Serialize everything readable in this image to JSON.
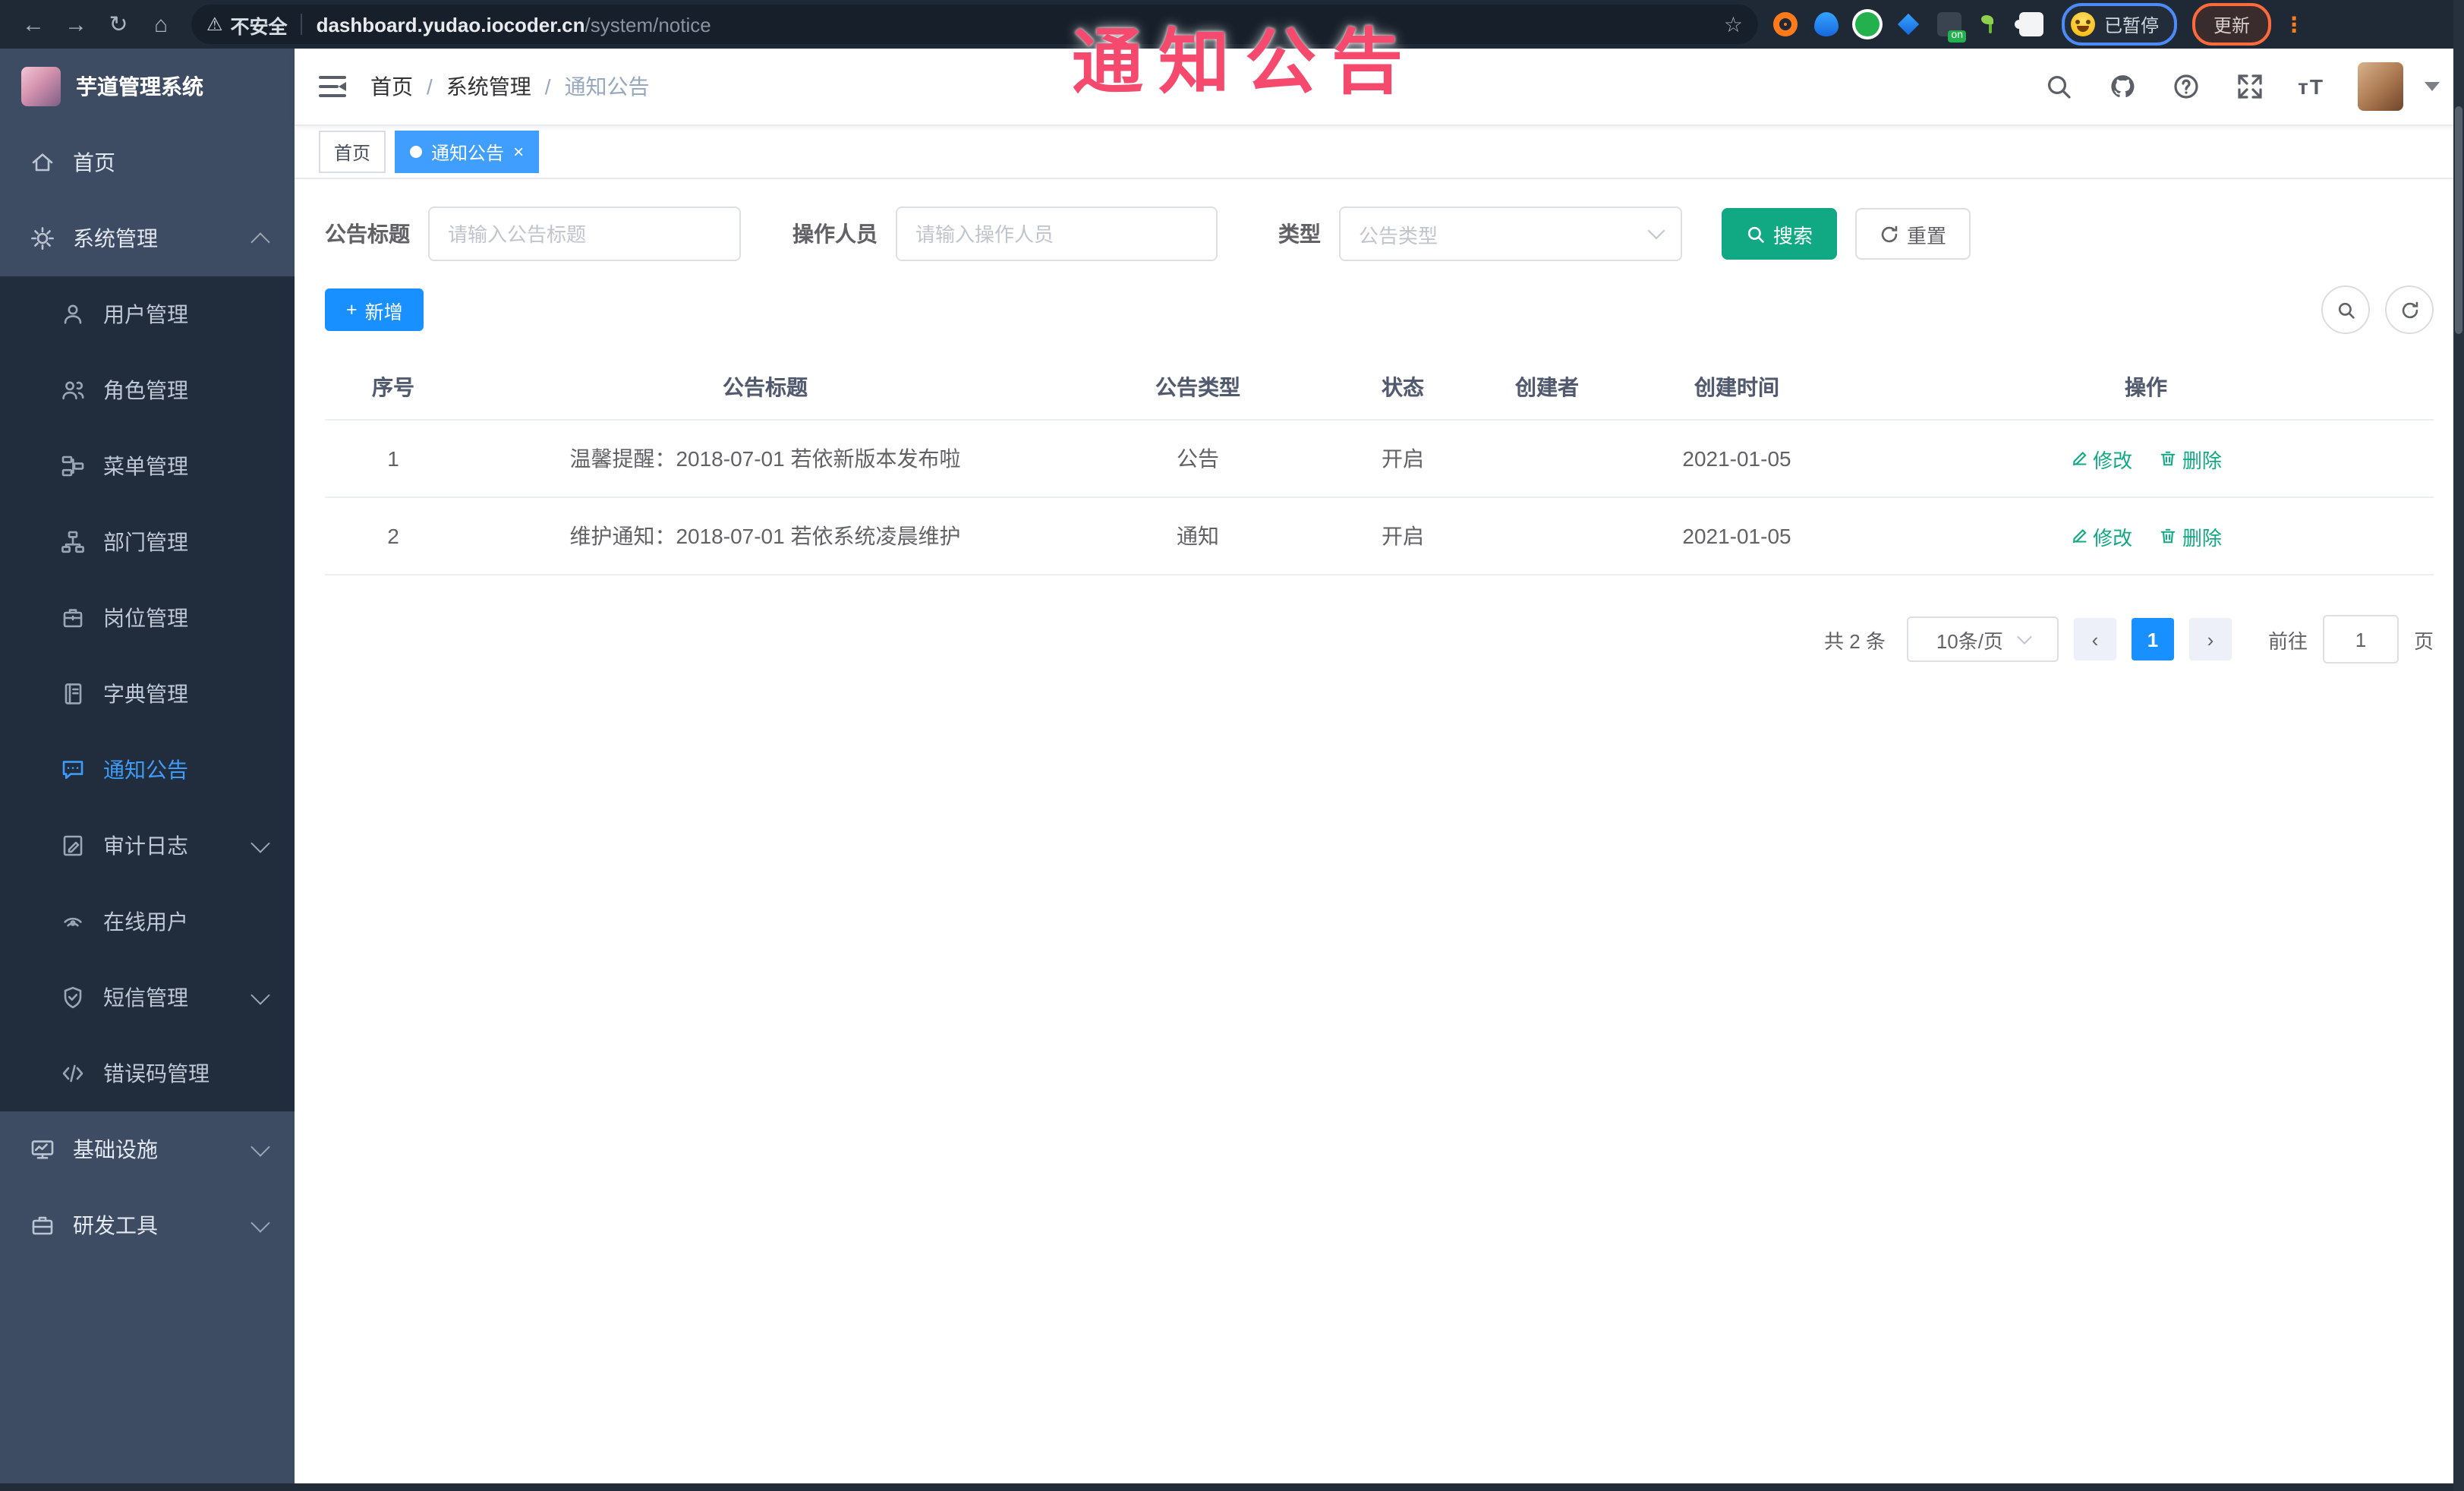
{
  "watermark": {
    "text": "通知公告",
    "color": "#f54a6e"
  },
  "browser": {
    "back_icon": "←",
    "forward_icon": "→",
    "reload_icon": "↻",
    "home_icon": "⌂",
    "warning_icon": "⚠",
    "security_label": "不安全",
    "url_host": "dashboard.yudao.iocoder.cn",
    "url_path": "/system/notice",
    "star_icon": "☆",
    "profile_label": "已暂停",
    "update_label": "更新",
    "menu_icon": "⋮"
  },
  "sidebar": {
    "logo_title": "芋道管理系统",
    "items": [
      {
        "label": "首页"
      },
      {
        "label": "系统管理"
      },
      {
        "label": "用户管理"
      },
      {
        "label": "角色管理"
      },
      {
        "label": "菜单管理"
      },
      {
        "label": "部门管理"
      },
      {
        "label": "岗位管理"
      },
      {
        "label": "字典管理"
      },
      {
        "label": "通知公告"
      },
      {
        "label": "审计日志"
      },
      {
        "label": "在线用户"
      },
      {
        "label": "短信管理"
      },
      {
        "label": "错误码管理"
      },
      {
        "label": "基础设施"
      },
      {
        "label": "研发工具"
      }
    ]
  },
  "header": {
    "breadcrumb": [
      "首页",
      "系统管理",
      "通知公告"
    ],
    "breadcrumb_sep": "/"
  },
  "tags": {
    "home_label": "首页",
    "active_label": "通知公告",
    "close_glyph": "×"
  },
  "filters": {
    "title_label": "公告标题",
    "title_placeholder": "请输入公告标题",
    "operator_label": "操作人员",
    "operator_placeholder": "请输入操作人员",
    "type_label": "类型",
    "type_placeholder": "公告类型",
    "search_label": "搜索",
    "reset_label": "重置"
  },
  "toolbar": {
    "add_label": "新增"
  },
  "table": {
    "columns": [
      "序号",
      "公告标题",
      "公告类型",
      "状态",
      "创建者",
      "创建时间",
      "操作"
    ],
    "rows": [
      {
        "no": "1",
        "title": "温馨提醒：2018-07-01 若依新版本发布啦",
        "type": "公告",
        "status": "开启",
        "creator": "",
        "created": "2021-01-05"
      },
      {
        "no": "2",
        "title": "维护通知：2018-07-01 若依系统凌晨维护",
        "type": "通知",
        "status": "开启",
        "creator": "",
        "created": "2021-01-05"
      }
    ],
    "action_edit": "修改",
    "action_delete": "删除"
  },
  "pagination": {
    "total": "共 2 条",
    "page_size": "10条/页",
    "prev": "‹",
    "next": "›",
    "current": "1",
    "goto_label": "前往",
    "goto_value": "1",
    "page_label": "页"
  },
  "colors": {
    "primary_blue": "#1890ff",
    "menu_active_blue": "#409eff",
    "search_teal": "#11a983",
    "watermark_red": "#f54a6e",
    "toolbar_dark": "#1f2935",
    "sidebar_light": "#3d4b63",
    "sidebar_dark": "#212d3c"
  }
}
